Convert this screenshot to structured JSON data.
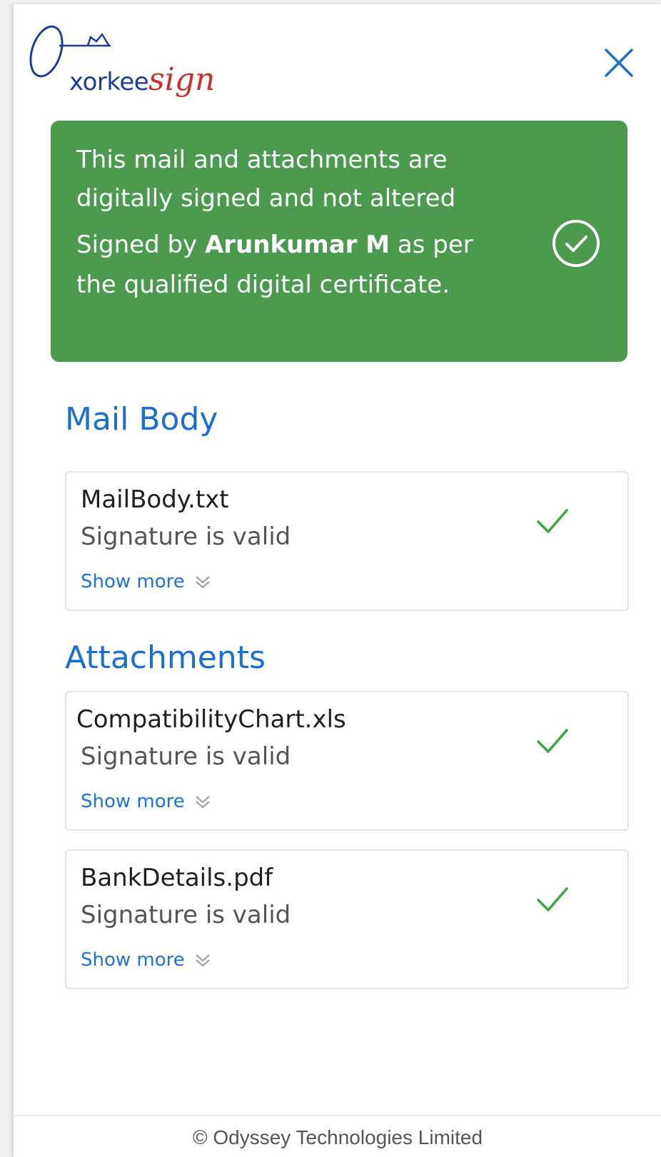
{
  "header": {
    "logo": {
      "text_primary": "xorkee",
      "text_secondary": "sign",
      "icon": "key-icon"
    },
    "close_icon": "close-icon"
  },
  "status_banner": {
    "message": "This mail and attachments are digitally signed and not altered",
    "signed_prefix": "Signed by",
    "signer": "Arunkumar M",
    "signed_suffix": "as per the qualified digital certificate.",
    "icon": "check-circle-icon",
    "background_color": "#4c9a4e"
  },
  "mail_body_section": {
    "title": "Mail Body",
    "items": [
      {
        "file_name": "MailBody.txt",
        "status": "Signature is valid",
        "show_more": "Show more",
        "status_icon": "check-icon"
      }
    ]
  },
  "attachments_section": {
    "title": "Attachments",
    "items": [
      {
        "file_name": "CompatibilityChart.xls",
        "status": "Signature is valid",
        "show_more": "Show more",
        "status_icon": "check-icon"
      },
      {
        "file_name": "BankDetails.pdf",
        "status": "Signature is valid",
        "show_more": "Show more",
        "status_icon": "check-icon"
      }
    ]
  },
  "footer": {
    "copyright": "© Odyssey Technologies Limited"
  },
  "colors": {
    "accent_blue": "#1a6fd1",
    "success_green": "#3aa646"
  }
}
